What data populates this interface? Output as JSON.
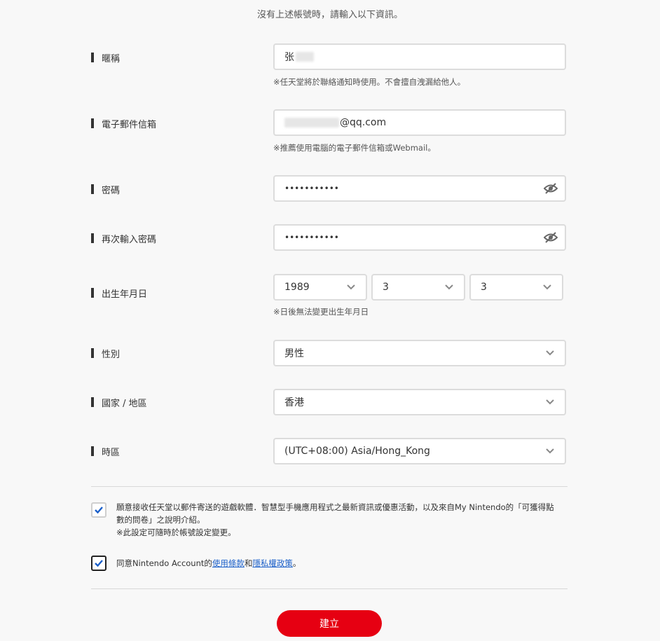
{
  "intro": "沒有上述帳號時，請輸入以下資訊。",
  "fields": {
    "nickname": {
      "label": "暱稱",
      "value": "张",
      "note": "※任天堂將於聯絡通知時使用。不會擅自洩漏給他人。"
    },
    "email": {
      "label": "電子郵件信箱",
      "value": "@qq.com",
      "note": "※推薦使用電腦的電子郵件信箱或Webmail。"
    },
    "password": {
      "label": "密碼",
      "value": "•••••••••••"
    },
    "password_confirm": {
      "label": "再次輸入密碼",
      "value": "•••••••••••"
    },
    "birthday": {
      "label": "出生年月日",
      "year": "1989",
      "month": "3",
      "day": "3",
      "note": "※日後無法變更出生年月日"
    },
    "gender": {
      "label": "性別",
      "value": "男性"
    },
    "country": {
      "label": "國家 / 地區",
      "value": "香港"
    },
    "timezone": {
      "label": "時區",
      "value": "(UTC+08:00) Asia/Hong_Kong"
    }
  },
  "newsletter": {
    "checked": true,
    "line1": "願意接收任天堂以郵件寄送的遊戲軟體．智慧型手機應用程式之最新資訊或優惠活動，以及來自My Nintendo的「可獲得點",
    "line2": "數的問卷」之說明介紹。",
    "line3": "※此設定可隨時於帳號設定變更。"
  },
  "agree": {
    "checked": true,
    "prefix": "同意Nintendo Account的",
    "terms_link": "使用條款",
    "and": "和",
    "privacy_link": "隱私權政策",
    "suffix": "。"
  },
  "submit_label": "建立",
  "colors": {
    "accent": "#e60012",
    "link": "#1a5fc9",
    "check": "#1a5fc9"
  }
}
